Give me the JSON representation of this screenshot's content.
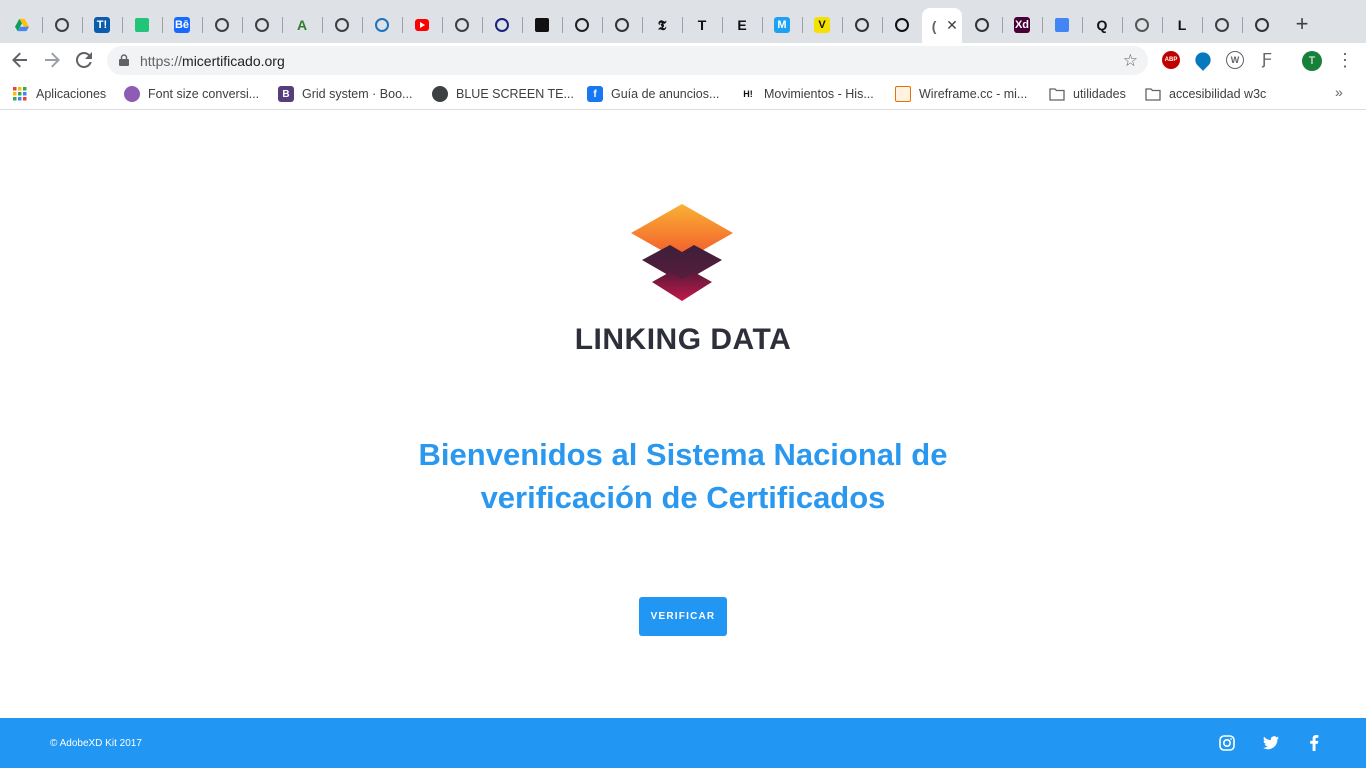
{
  "browser": {
    "tabs": [
      {
        "icon": "google-drive-icon",
        "color": "#0f9d58"
      },
      {
        "icon": "globe-icon",
        "color": "#3c4043"
      },
      {
        "icon": "t-logo-icon",
        "glyph": "T!",
        "color": "#0b5cad"
      },
      {
        "icon": "green-square-icon",
        "color": "#22c47a"
      },
      {
        "icon": "behance-icon",
        "glyph": "Bē",
        "color": "#1769ff"
      },
      {
        "icon": "globe-icon",
        "color": "#3c4043"
      },
      {
        "icon": "printer-icon",
        "color": "#3c4043"
      },
      {
        "icon": "a-letter-icon",
        "glyph": "A",
        "color": "#2e7d32"
      },
      {
        "icon": "globe-icon",
        "color": "#3c4043"
      },
      {
        "icon": "bird-icon",
        "color": "#1e73be"
      },
      {
        "icon": "youtube-icon",
        "color": "#ff0000"
      },
      {
        "icon": "globe-icon",
        "color": "#3c4043"
      },
      {
        "icon": "circle-logo-icon",
        "color": "#1a237e"
      },
      {
        "icon": "black-square-icon",
        "color": "#111111"
      },
      {
        "icon": "stripes-icon",
        "color": "#222222"
      },
      {
        "icon": "face-icon",
        "color": "#333333"
      },
      {
        "icon": "nyt-icon",
        "glyph": "𝕿",
        "color": "#111111"
      },
      {
        "icon": "t-serif-icon",
        "glyph": "T",
        "color": "#111111"
      },
      {
        "icon": "e-letter-icon",
        "glyph": "E",
        "color": "#111111"
      },
      {
        "icon": "m-square-icon",
        "glyph": "M",
        "color": "#1da1f2"
      },
      {
        "icon": "v-letter-icon",
        "glyph": "V",
        "color": "#f5e100"
      },
      {
        "icon": "pdf-icon",
        "color": "#333333"
      },
      {
        "icon": "eye-icon",
        "color": "#111111"
      },
      {
        "icon": "active-tab-icon",
        "glyph": "(",
        "color": "#5f6368"
      },
      {
        "icon": "c-circle-icon",
        "color": "#333333"
      },
      {
        "icon": "adobe-xd-icon",
        "glyph": "Xd",
        "color": "#470137"
      },
      {
        "icon": "google-docs-icon",
        "color": "#4285f4"
      },
      {
        "icon": "q-letter-icon",
        "glyph": "Q",
        "color": "#111111"
      },
      {
        "icon": "stack-icon",
        "color": "#555555"
      },
      {
        "icon": "l-letter-icon",
        "glyph": "L",
        "color": "#111111"
      },
      {
        "icon": "globe-icon",
        "color": "#3c4043"
      },
      {
        "icon": "chrome-icon",
        "color": "#333333"
      }
    ],
    "new_tab_label": "+",
    "url_scheme": "https://",
    "url_host": "micertificado.org",
    "profile_initial": "T",
    "extensions": [
      {
        "icon": "adblock-icon",
        "glyph": "ABP",
        "color": "#c00000"
      },
      {
        "icon": "drupal-icon",
        "glyph": "",
        "color": "#0678be"
      },
      {
        "icon": "wappalyzer-icon",
        "glyph": "W",
        "color": "#5f6368"
      },
      {
        "icon": "font-icon",
        "glyph": "Ƒ",
        "color": "#5f6368"
      }
    ]
  },
  "bookmarks": [
    {
      "label": "Aplicaciones",
      "icon": "apps-grid-icon"
    },
    {
      "label": "Font size conversi...",
      "icon": "font-size-icon",
      "color": "#8e5bb5"
    },
    {
      "label": "Grid system · Boo...",
      "icon": "bootstrap-icon",
      "glyph": "B",
      "color": "#563d7c"
    },
    {
      "label": "BLUE SCREEN TE...",
      "icon": "globe-icon",
      "color": "#3c4043"
    },
    {
      "label": "Guía de anuncios...",
      "icon": "facebook-icon",
      "glyph": "f",
      "color": "#1877f2"
    },
    {
      "label": "Movimientos - His...",
      "icon": "ha-icon",
      "glyph": "H!",
      "color": "#111111"
    },
    {
      "label": "Wireframe.cc - mi...",
      "icon": "wireframe-icon",
      "color": "#e8710a"
    },
    {
      "label": "utilidades",
      "icon": "folder-icon"
    },
    {
      "label": "accesibilidad w3c",
      "icon": "folder-icon"
    }
  ],
  "bookmarks_more": "»",
  "page": {
    "logo_text": "LINKING  DATA",
    "headline_line1": "Bienvenidos al Sistema Nacional de",
    "headline_line2": "verificación de Certificados",
    "verify_button": "VERIFICAR",
    "accent_color": "#2196f3"
  },
  "footer": {
    "copyright": "© AdobeXD Kit 2017",
    "social": [
      "instagram-icon",
      "twitter-icon",
      "facebook-icon"
    ]
  }
}
